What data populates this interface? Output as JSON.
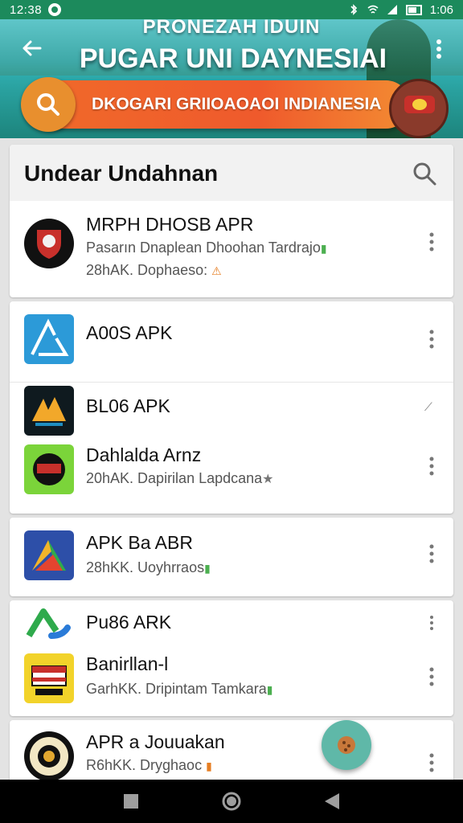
{
  "status_bar": {
    "time_left": "12:38",
    "time_right": "1:06"
  },
  "header": {
    "subtitle": "PRONEZAH IDUIN",
    "title": "PUGAR UNI DAYNESIAI",
    "search_banner_text": "DKOGARI GRIIOAOAOI INDIANESIA"
  },
  "list_card": {
    "title": "Undear Undahnan"
  },
  "apps": [
    {
      "name": "MRPH DHOSB APR",
      "line1": "Pasarın Dnaplean Dhoohan  Tardrajo",
      "line1_badge": "▮",
      "line2": "28hAK. Dophaeso:",
      "line2_badge": "⚠"
    },
    {
      "name": "A00S APK"
    },
    {
      "name": "BL06 APK"
    },
    {
      "name": "Dahlalda Arnz",
      "line1": "20hAK. Dapirilan Lapdcana",
      "line1_badge": "★"
    },
    {
      "name": "APK Ba ABR",
      "line1": "28hKK. Uoyhrraos",
      "line1_badge": "▮"
    },
    {
      "name": "Pu86 ARK"
    },
    {
      "name": "Banirllan-l",
      "line1": "GarhKK. Dripintam Tamkara",
      "line1_badge": "▮"
    },
    {
      "name": "APR a Jouuakan",
      "line1": "R6hKK. Dryghaoc",
      "line1_badge": "▮"
    }
  ],
  "colors": {
    "status_bar": "#1c8a5c",
    "search_pill": "#f06a2a",
    "search_button": "#e88f2e",
    "fab": "#5fb8a8",
    "badge_green": "#4caf50"
  },
  "icons": {
    "back": "arrow-left-icon",
    "overflow": "more-vert-icon",
    "search": "search-icon",
    "fab": "cookie-icon"
  }
}
